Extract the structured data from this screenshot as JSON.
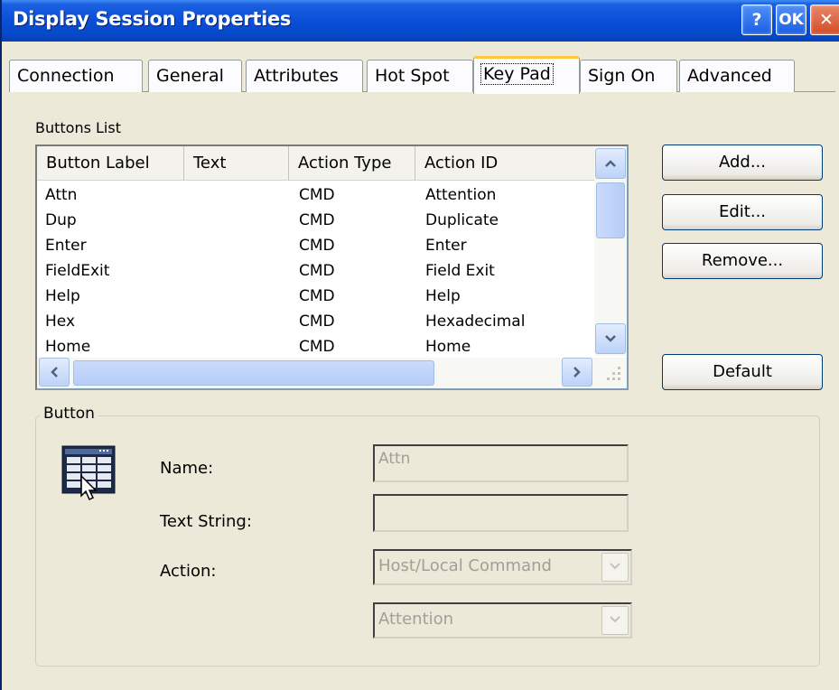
{
  "window": {
    "title": "Display Session Properties",
    "help_label": "?",
    "ok_label": "OK",
    "close_label": "✕"
  },
  "tabs": [
    {
      "label": "Connection"
    },
    {
      "label": "General"
    },
    {
      "label": "Attributes"
    },
    {
      "label": "Hot Spot"
    },
    {
      "label": "Key Pad",
      "active": true
    },
    {
      "label": "Sign On"
    },
    {
      "label": "Advanced"
    }
  ],
  "buttons_list": {
    "label": "Buttons List",
    "columns": [
      "Button Label",
      "Text",
      "Action Type",
      "Action ID"
    ],
    "rows": [
      [
        "Attn",
        "",
        "CMD",
        "Attention"
      ],
      [
        "Dup",
        "",
        "CMD",
        "Duplicate"
      ],
      [
        "Enter",
        "",
        "CMD",
        "Enter"
      ],
      [
        "FieldExit",
        "",
        "CMD",
        "Field Exit"
      ],
      [
        "Help",
        "",
        "CMD",
        "Help"
      ],
      [
        "Hex",
        "",
        "CMD",
        "Hexadecimal"
      ],
      [
        "Home",
        "",
        "CMD",
        "Home"
      ]
    ]
  },
  "actions": {
    "add": "Add...",
    "edit": "Edit...",
    "remove": "Remove...",
    "default": "Default"
  },
  "button_group": {
    "title": "Button",
    "name_label": "Name:",
    "name_value": "Attn",
    "text_string_label": "Text String:",
    "text_string_value": "",
    "action_label": "Action:",
    "action_type": "Host/Local Command",
    "action_id": "Attention"
  },
  "icons": {
    "scroll_up": "chevron-up-icon",
    "scroll_down": "chevron-down-icon",
    "scroll_left": "chevron-left-icon",
    "scroll_right": "chevron-right-icon",
    "keypad": "keypad-icon"
  },
  "colors": {
    "titlebar": "#0a4fd8",
    "tab_highlight": "#ffc83c",
    "close_button": "#d24d27"
  }
}
